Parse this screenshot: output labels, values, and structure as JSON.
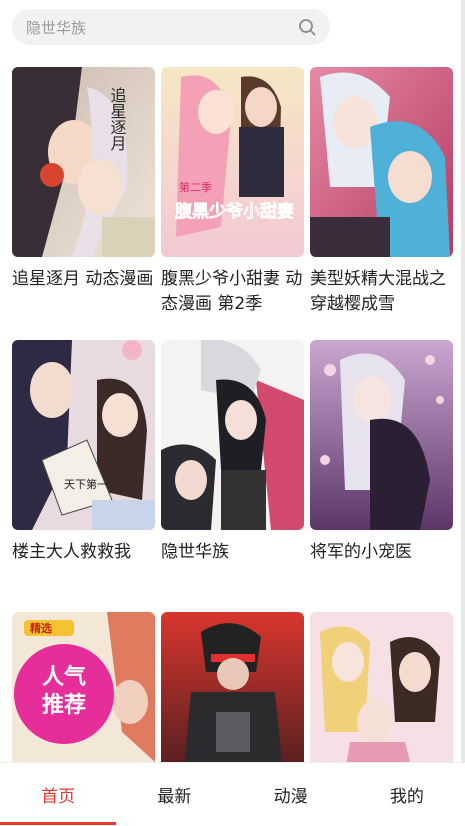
{
  "search": {
    "placeholder": "隐世华族"
  },
  "comics": [
    {
      "title": "追星逐月 动态漫画",
      "cover_text": "追星逐月"
    },
    {
      "title": "腹黑少爷小甜妻 动态漫画 第2季",
      "cover_text_top": "第二季",
      "cover_text": "腹黑少爷小甜妻"
    },
    {
      "title": "美型妖精大混战之穿越樱成雪",
      "cover_text": ""
    },
    {
      "title": "楼主大人救救我",
      "cover_text": "天下第一"
    },
    {
      "title": "隐世华族",
      "cover_text": ""
    },
    {
      "title": "将军的小宠医",
      "cover_text": ""
    },
    {
      "title": "",
      "badge_top": "精选",
      "badge_line1": "人气",
      "badge_line2": "推荐"
    },
    {
      "title": "",
      "cover_text": ""
    },
    {
      "title": "",
      "cover_text": ""
    }
  ],
  "tabs": [
    {
      "label": "首页",
      "active": true
    },
    {
      "label": "最新",
      "active": false
    },
    {
      "label": "动漫",
      "active": false
    },
    {
      "label": "我的",
      "active": false
    }
  ],
  "colors": {
    "accent": "#e8382f",
    "search_bg": "#f2f2f2"
  }
}
